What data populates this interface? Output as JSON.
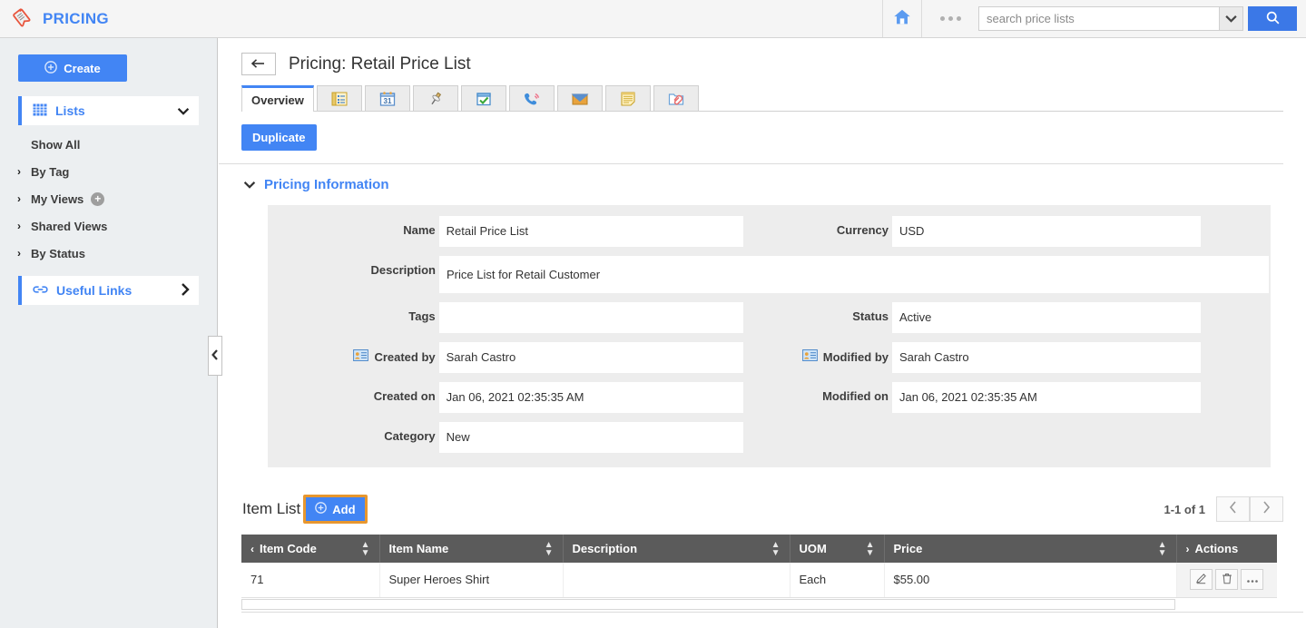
{
  "topbar": {
    "brand": "PRICING",
    "logo_icon": "price-tag-icon",
    "home_icon": "home-icon",
    "more_icon": "ellipsis-icon",
    "search": {
      "placeholder": "search price lists",
      "value": "",
      "caret_icon": "chevron-down-icon",
      "button_icon": "search-icon"
    }
  },
  "sidebar": {
    "create_label": "Create",
    "create_icon": "plus-circle-icon",
    "section": {
      "label": "Lists",
      "icon": "grid-icon",
      "chevron": "chevron-down-icon"
    },
    "items": [
      {
        "label": "Show All",
        "arrow": "",
        "badge": ""
      },
      {
        "label": "By Tag",
        "arrow": "›",
        "badge": ""
      },
      {
        "label": "My Views",
        "arrow": "›",
        "badge": "+"
      },
      {
        "label": "Shared Views",
        "arrow": "›",
        "badge": ""
      },
      {
        "label": "By Status",
        "arrow": "›",
        "badge": ""
      }
    ],
    "useful_links": {
      "label": "Useful Links",
      "icon": "link-icon",
      "chevron": "chevron-right-icon"
    },
    "collapse_icon": "chevron-left-icon"
  },
  "page": {
    "back_icon": "arrow-left-icon",
    "title": "Pricing: Retail Price List",
    "duplicate_label": "Duplicate"
  },
  "tabs": [
    {
      "label": "Overview",
      "icon": "",
      "active": true
    },
    {
      "label": "",
      "icon": "details-icon",
      "active": false
    },
    {
      "label": "",
      "icon": "calendar-icon",
      "active": false
    },
    {
      "label": "",
      "icon": "pin-icon",
      "active": false
    },
    {
      "label": "",
      "icon": "task-checkbox-icon",
      "active": false
    },
    {
      "label": "",
      "icon": "phone-call-icon",
      "active": false
    },
    {
      "label": "",
      "icon": "email-envelope-icon",
      "active": false
    },
    {
      "label": "",
      "icon": "notes-icon",
      "active": false
    },
    {
      "label": "",
      "icon": "attachment-folder-icon",
      "active": false
    }
  ],
  "section": {
    "title": "Pricing Information",
    "chevron": "chevron-down-icon"
  },
  "form": {
    "name": {
      "label": "Name",
      "value": "Retail Price List"
    },
    "currency": {
      "label": "Currency",
      "value": "USD"
    },
    "description": {
      "label": "Description",
      "value": "Price List for Retail Customer"
    },
    "tags": {
      "label": "Tags",
      "value": ""
    },
    "status": {
      "label": "Status",
      "value": "Active"
    },
    "created_by": {
      "label": "Created by",
      "value": "Sarah Castro",
      "icon": "contact-card-icon"
    },
    "modified_by": {
      "label": "Modified by",
      "value": "Sarah Castro",
      "icon": "contact-card-icon"
    },
    "created_on": {
      "label": "Created on",
      "value": "Jan 06, 2021 02:35:35 AM"
    },
    "modified_on": {
      "label": "Modified on",
      "value": "Jan 06, 2021 02:35:35 AM"
    },
    "category": {
      "label": "Category",
      "value": "New"
    }
  },
  "item_list": {
    "title": "Item List",
    "add_label": "Add",
    "add_icon": "plus-circle-icon",
    "pager_label": "1-1 of 1",
    "prev_icon": "chevron-left-icon",
    "next_icon": "chevron-right-icon",
    "columns": [
      {
        "label": "Item Code",
        "sortable": true,
        "lead": "‹"
      },
      {
        "label": "Item Name",
        "sortable": true,
        "lead": ""
      },
      {
        "label": "Description",
        "sortable": true,
        "lead": ""
      },
      {
        "label": "UOM",
        "sortable": true,
        "lead": ""
      },
      {
        "label": "Price",
        "sortable": true,
        "lead": ""
      },
      {
        "label": "Actions",
        "sortable": false,
        "lead": "›"
      }
    ],
    "rows": [
      {
        "item_code": "71",
        "item_name": "Super Heroes Shirt",
        "description": "",
        "uom": "Each",
        "price": "$55.00",
        "actions": [
          "edit-icon",
          "delete-icon",
          "more-icon"
        ]
      }
    ]
  },
  "colors": {
    "accent": "#4285f4",
    "header_bar": "#f5f5f5",
    "sidebar_bg": "#eceff1",
    "table_header": "#5b5b5b",
    "highlight_ring": "#e8972e",
    "panel_bg": "#ededed"
  }
}
